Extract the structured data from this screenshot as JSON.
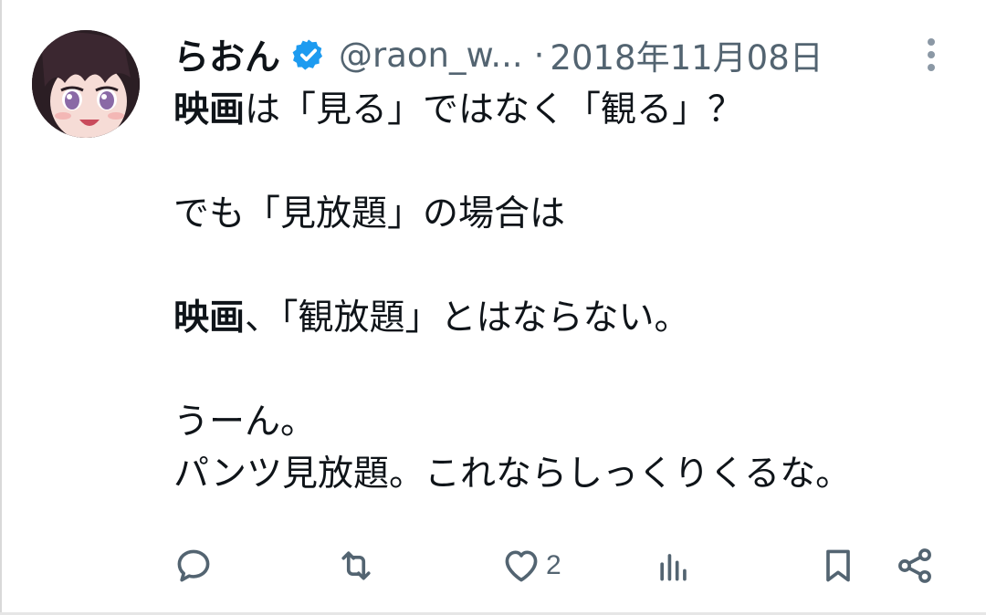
{
  "tweet": {
    "display_name": "らおん",
    "handle": "@raon_w...",
    "separator": "·",
    "date": "2018年11月08日",
    "lines": [
      {
        "bold": "映画",
        "text": "は「見る」ではなく「観る」？"
      },
      {
        "bold": "",
        "text": ""
      },
      {
        "bold": "",
        "text": "でも「見放題」の場合は"
      },
      {
        "bold": "",
        "text": ""
      },
      {
        "bold": "映画",
        "text": "、「観放題」とはならない。"
      },
      {
        "bold": "",
        "text": ""
      },
      {
        "bold": "",
        "text": "うーん。"
      },
      {
        "bold": "",
        "text": "パンツ見放題。これならしっくりくるな。"
      }
    ]
  },
  "actions": {
    "reply": {
      "icon": "reply-icon",
      "count": ""
    },
    "retweet": {
      "icon": "retweet-icon",
      "count": ""
    },
    "like": {
      "icon": "heart-icon",
      "count": "2"
    },
    "views": {
      "icon": "analytics-icon",
      "count": ""
    },
    "bookmark": {
      "icon": "bookmark-icon",
      "count": ""
    },
    "share": {
      "icon": "share-icon",
      "count": ""
    }
  },
  "colors": {
    "text_primary": "#0f1419",
    "text_secondary": "#536471",
    "verified_blue": "#1d9bf0"
  }
}
